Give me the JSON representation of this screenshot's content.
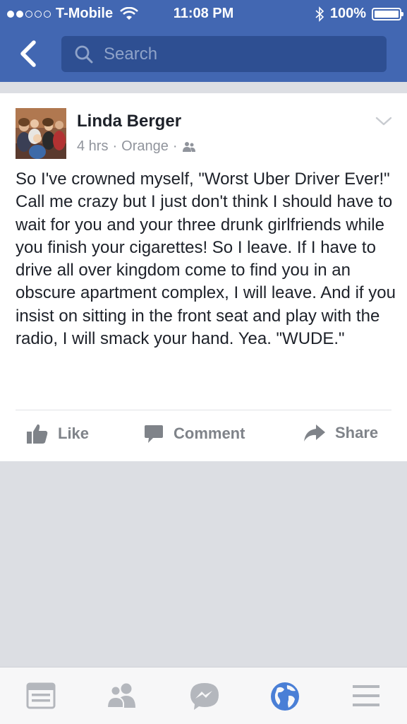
{
  "status_bar": {
    "carrier": "T-Mobile",
    "time": "11:08 PM",
    "battery": "100%",
    "signal_bars_filled": 2,
    "signal_bars_total": 5
  },
  "header": {
    "search_placeholder": "Search",
    "back_icon": "chevron-left-icon"
  },
  "post": {
    "author": "Linda Berger",
    "time_ago": "4 hrs",
    "location": "Orange",
    "separator": "·",
    "audience_icon": "friends-icon",
    "text": "So I've crowned myself, \"Worst Uber Driver Ever!\"  Call me crazy but I just don't think I should have to wait for you and your three drunk girlfriends while you finish your cigarettes!  So I leave. If I have to drive all over kingdom come to find you in an obscure apartment complex, I will leave. And if you insist on sitting in the front seat and play with the radio, I will smack your hand. Yea. \"WUDE.\""
  },
  "actions": {
    "like": "Like",
    "comment": "Comment",
    "share": "Share"
  },
  "bottom_nav": [
    "news-feed-icon",
    "friends-icon",
    "messenger-icon",
    "globe-notifications-icon",
    "menu-icon"
  ],
  "colors": {
    "brand_blue": "#4267b2",
    "search_bg": "#2e4f92",
    "active_nav": "#4a7fd6",
    "text": "#1d2129",
    "meta": "#90949c"
  }
}
